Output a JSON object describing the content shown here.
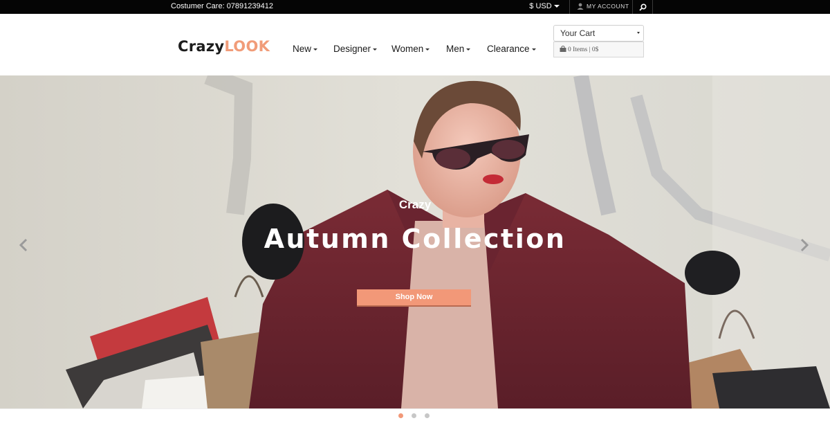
{
  "topbar": {
    "customer_care": "Costumer Care: 07891239412",
    "currency": "$ USD",
    "account": "MY ACCOUNT",
    "search_icon": "magnifier-icon"
  },
  "header": {
    "logo_crazy": "Crazy",
    "logo_look": "LOOK",
    "nav": [
      {
        "label": "New"
      },
      {
        "label": "Designer"
      },
      {
        "label": "Women"
      },
      {
        "label": "Men"
      },
      {
        "label": "Clearance"
      }
    ],
    "cart": {
      "label": "Your Cart",
      "summary": "0 Items | 0$"
    }
  },
  "hero": {
    "kicker": "Crazy",
    "headline": "Autumn Collection",
    "cta": "Shop Now",
    "prev_icon": "chevron-left-icon",
    "next_icon": "chevron-right-icon"
  },
  "carousel": {
    "slides": 3,
    "active_slide": 1
  },
  "colors": {
    "accent": "#f29878",
    "logo_accent": "#f19c79",
    "topbar": "#050505"
  }
}
